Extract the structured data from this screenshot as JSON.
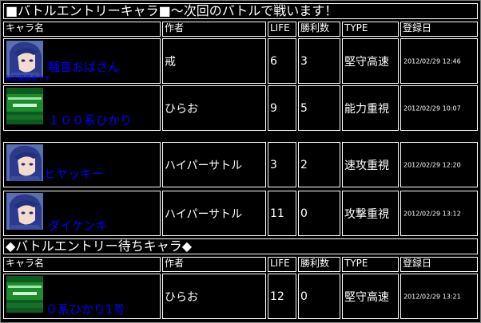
{
  "entry_section": {
    "title": "■バトルエントリーキャラ■～次回のバトルで戦います！",
    "headers": [
      "キャラ名",
      "作者",
      "LIFE",
      "勝利数",
      "TYPE",
      "登録日"
    ],
    "rows": [
      {
        "name": "騒音おばさん",
        "note": "前回優勝者です",
        "author": "戒",
        "life": "6",
        "wins": "3",
        "type": "堅守高速",
        "date": "2012/02/29 12:46",
        "avatar": "anime-girl"
      },
      {
        "name": "１００系ひかり",
        "note": "",
        "author": "ひらお",
        "life": "9",
        "wins": "5",
        "type": "能力重視",
        "date": "2012/02/29 10:07",
        "avatar": "green-train"
      },
      {
        "name": "ヒヤッキー",
        "note": "",
        "author": "ハイパーサトル",
        "life": "3",
        "wins": "2",
        "type": "速攻重視",
        "date": "2012/02/29 12:20",
        "avatar": "anime-girl"
      },
      {
        "name": "ダイケンキ",
        "note": "",
        "author": "ハイパーサトル",
        "life": "11",
        "wins": "0",
        "type": "攻撃重視",
        "date": "2012/02/29 13:12",
        "avatar": "anime-girl"
      }
    ]
  },
  "waiting_section": {
    "title": "◆バトルエントリー待ちキャラ◆",
    "headers": [
      "キャラ名",
      "作者",
      "LIFE",
      "勝利数",
      "TYPE",
      "登録日"
    ],
    "rows": [
      {
        "name": "０系ひかり1号",
        "note": "",
        "author": "ひらお",
        "life": "12",
        "wins": "0",
        "type": "堅守高速",
        "date": "2012/02/29 13:21",
        "avatar": "green-train"
      }
    ]
  },
  "colors": {
    "background": "#000000",
    "border": "#ffffff",
    "name_link": "#0000ff",
    "train_green": "#1f8a2e"
  }
}
